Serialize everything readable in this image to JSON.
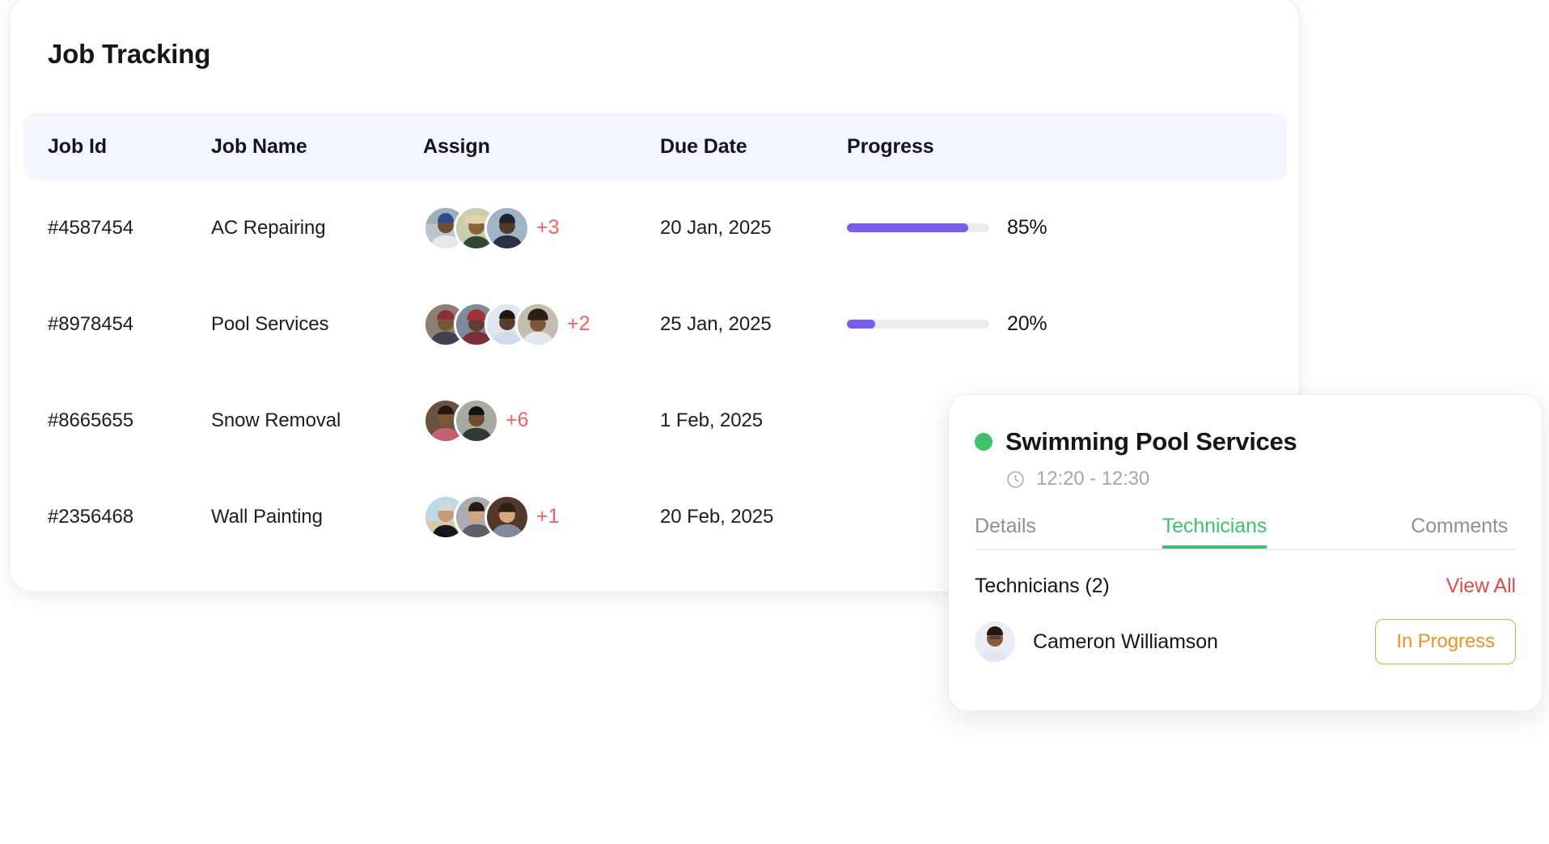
{
  "card": {
    "title": "Job Tracking"
  },
  "table": {
    "columns": [
      {
        "key": "job_id",
        "label": "Job Id"
      },
      {
        "key": "job_name",
        "label": "Job Name"
      },
      {
        "key": "assign",
        "label": "Assign"
      },
      {
        "key": "due_date",
        "label": "Due Date"
      },
      {
        "key": "progress",
        "label": "Progress"
      }
    ],
    "rows": [
      {
        "job_id": "#4587454",
        "job_name": "AC Repairing",
        "assignee_avatars": 3,
        "assignee_more": "+3",
        "due_date": "20 Jan, 2025",
        "progress_value": 85,
        "progress_label": "85%"
      },
      {
        "job_id": "#8978454",
        "job_name": "Pool Services",
        "assignee_avatars": 4,
        "assignee_more": "+2",
        "due_date": "25 Jan, 2025",
        "progress_value": 20,
        "progress_label": "20%"
      },
      {
        "job_id": "#8665655",
        "job_name": "Snow Removal",
        "assignee_avatars": 2,
        "assignee_more": "+6",
        "due_date": "1 Feb, 2025",
        "progress_value": null,
        "progress_label": ""
      },
      {
        "job_id": "#2356468",
        "job_name": "Wall Painting",
        "assignee_avatars": 3,
        "assignee_more": "+1",
        "due_date": "20 Feb, 2025",
        "progress_value": null,
        "progress_label": ""
      }
    ]
  },
  "popup": {
    "status": "active",
    "title": "Swimming Pool Services",
    "clock_icon": "clock-icon",
    "time_range": "12:20 - 12:30",
    "tabs": [
      {
        "label": "Details",
        "active": false
      },
      {
        "label": "Technicians",
        "active": true
      },
      {
        "label": "Comments",
        "active": false
      }
    ],
    "technicians_heading": "Technicians (2)",
    "view_all_label": "View All",
    "technicians": [
      {
        "name": "Cameron Williamson",
        "status_label": "In Progress"
      }
    ]
  },
  "colors": {
    "progress_fill": "#7c5cf0",
    "progress_track": "#ededef",
    "header_bg": "#f3f6fd",
    "more_count": "#f4605f",
    "status_dot": "#3fc16b",
    "tab_active": "#3fc16b",
    "view_all": "#e04b4b",
    "badge_in_progress": "#ef9320"
  }
}
